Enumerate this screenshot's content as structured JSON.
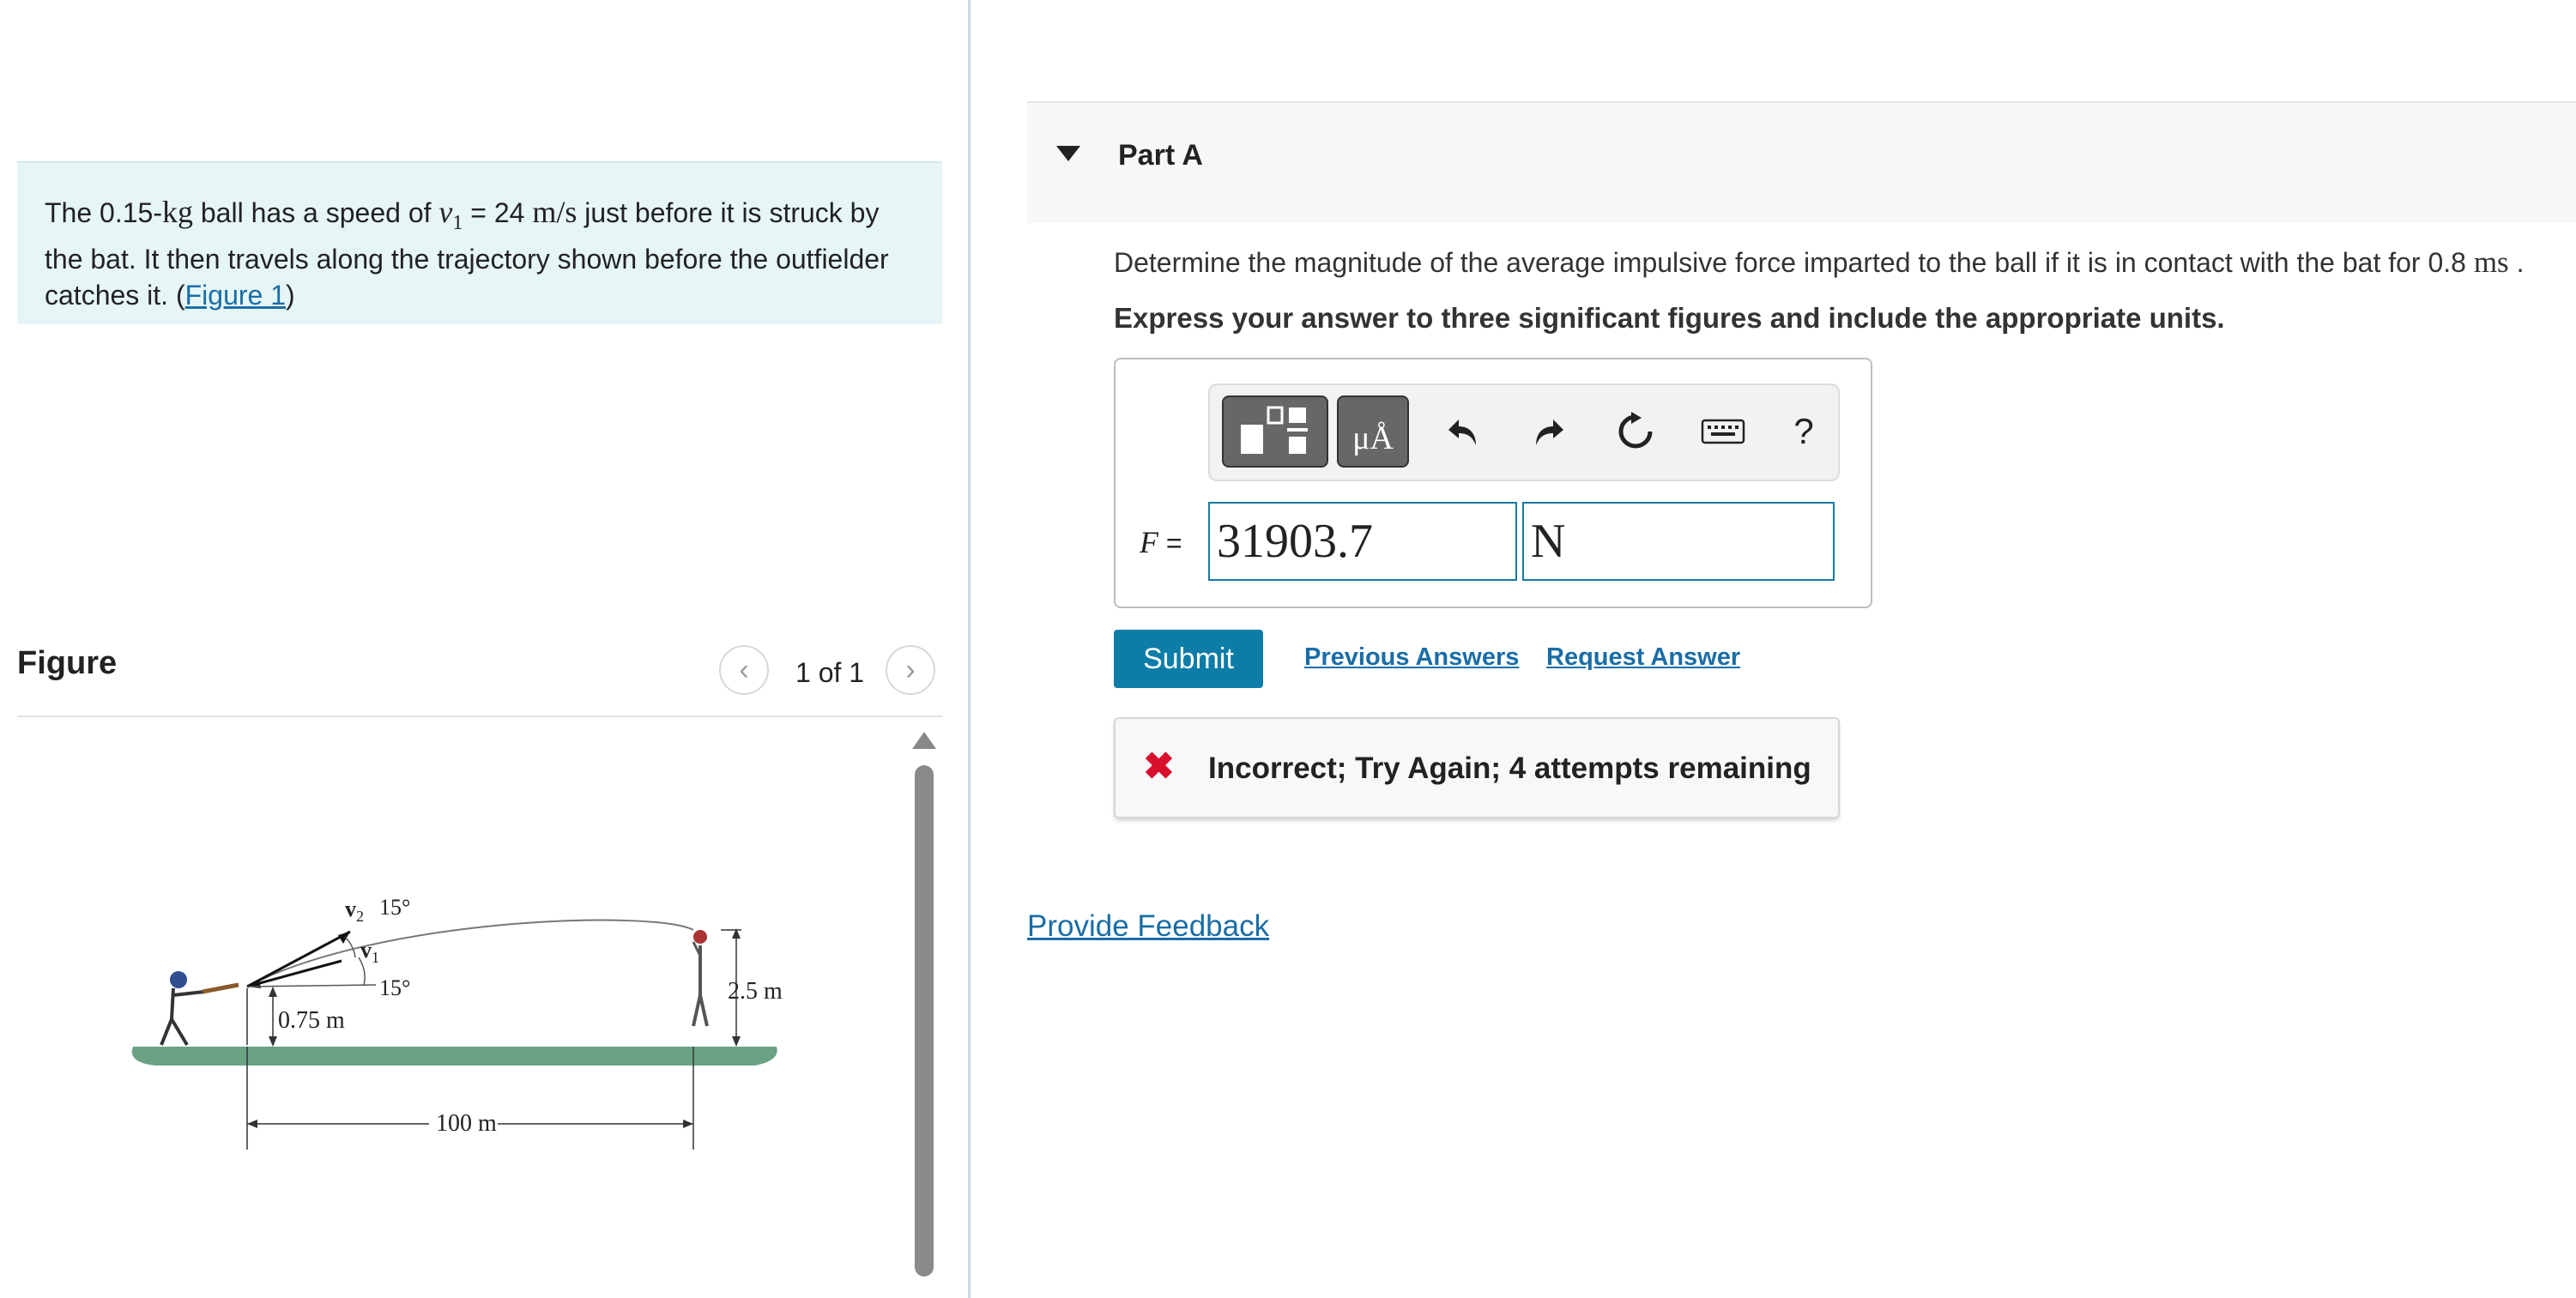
{
  "problem": {
    "text_before": "The 0.15-",
    "mass_unit": "kg",
    "text_mid": " ball has a speed of ",
    "velocity_symbol": "v",
    "velocity_subscript": "1",
    "equals": " = 24 ",
    "speed_unit": "m/s",
    "text_after": " just before it is struck by the bat. It then travels along the trajectory shown before the outfielder catches it. (",
    "figure_link": "Figure 1",
    "close_paren": ")"
  },
  "figure": {
    "heading": "Figure",
    "counter": "1 of 1",
    "labels": {
      "v2": "v",
      "v2_sub": "2",
      "v1": "v",
      "v1_sub": "1",
      "angle_top": "15°",
      "angle_bottom": "15°",
      "height_start": "0.75 m",
      "height_end": "2.5 m",
      "distance": "100 m"
    }
  },
  "part": {
    "title": "Part A",
    "question_prefix": "Determine the magnitude of the average impulsive force imparted to the ball if it is in contact with the bat for 0.8 ",
    "question_unit": "ms",
    "question_suffix": " .",
    "instruction": "Express your answer to three significant figures and include the appropriate units."
  },
  "answer": {
    "variable": "F",
    "equals": " = ",
    "value": "31903.7",
    "unit": "N",
    "units_button_label": "μÅ",
    "help_label": "?"
  },
  "actions": {
    "submit": "Submit",
    "previous_answers": "Previous Answers",
    "request_answer": "Request Answer"
  },
  "feedback": {
    "icon": "✖",
    "message": "Incorrect; Try Again; 4 attempts remaining"
  },
  "footer": {
    "provide_feedback": "Provide Feedback"
  },
  "colors": {
    "accent": "#0d7da8",
    "link": "#1a6da7",
    "error": "#d8102e",
    "problem_bg": "#e6f5f5",
    "ground": "#6aa384"
  }
}
